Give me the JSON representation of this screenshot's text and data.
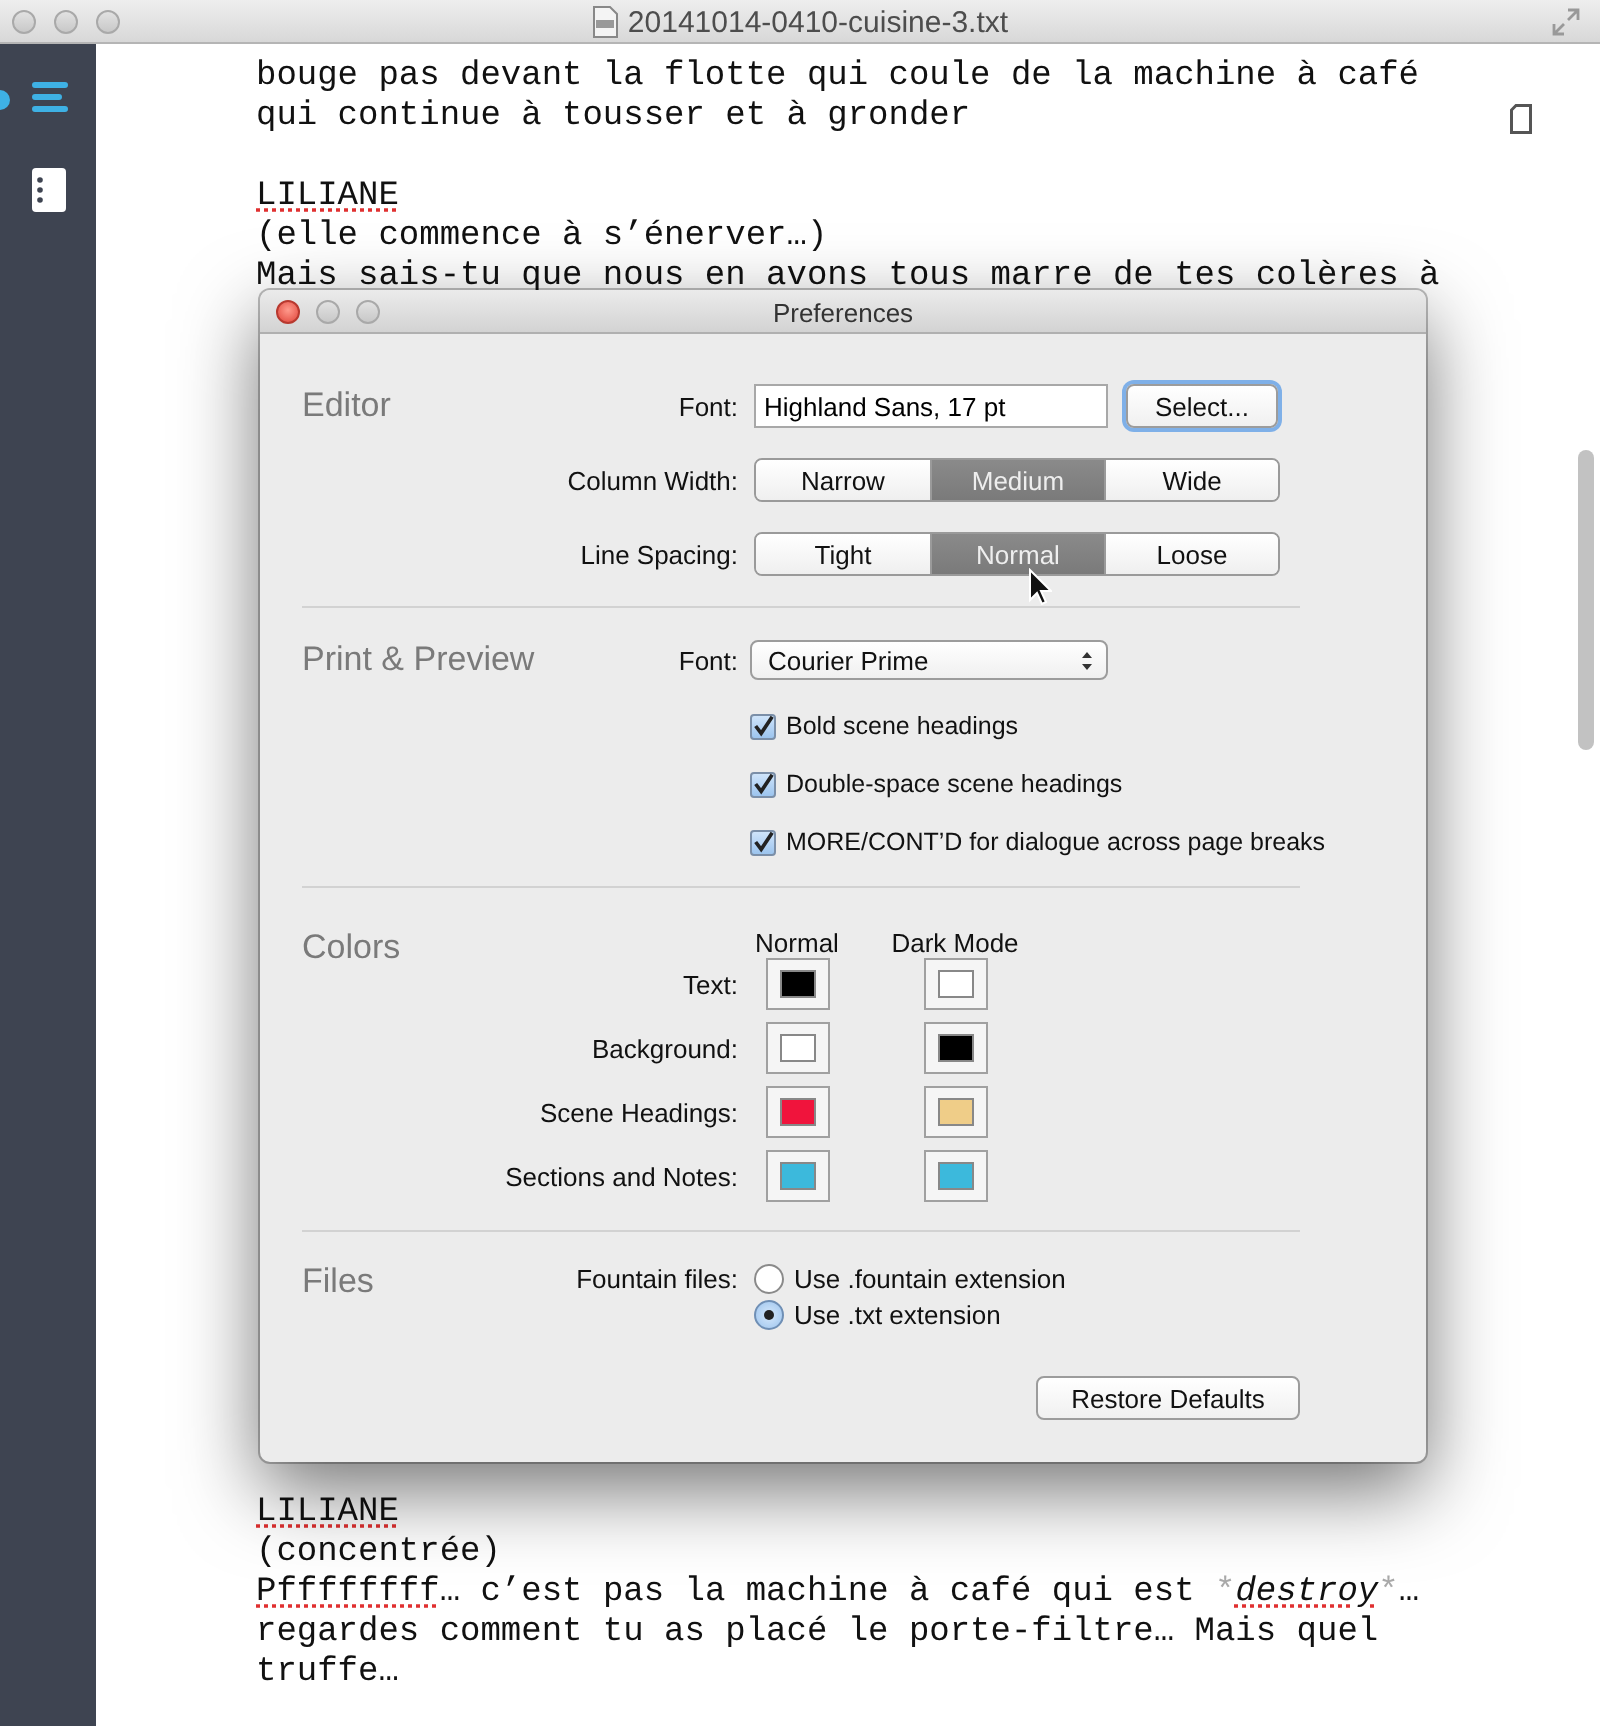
{
  "window": {
    "title": "20141014-0410-cuisine-3.txt"
  },
  "editor": {
    "lines_top": [
      {
        "kind": "text",
        "segments": [
          {
            "text": "bouge pas devant la flotte qui coule de la machine à café",
            "kind": "plain",
            "misspelled": false
          }
        ]
      },
      {
        "kind": "text",
        "segments": [
          {
            "text": "qui continue à tousser et à gronder",
            "kind": "plain",
            "misspelled": false
          }
        ]
      },
      {
        "kind": "blank"
      },
      {
        "kind": "text",
        "segments": [
          {
            "text": "LILIANE",
            "kind": "plain",
            "misspelled": true
          }
        ]
      },
      {
        "kind": "text",
        "segments": [
          {
            "text": "(elle commence à s’énerver…)",
            "kind": "plain",
            "misspelled": false
          }
        ]
      },
      {
        "kind": "text",
        "segments": [
          {
            "text": "Mais sais-tu que nous en avons tous marre de tes colères à",
            "kind": "plain",
            "misspelled": false
          }
        ]
      }
    ],
    "lines_bottom": [
      {
        "kind": "text",
        "segments": [
          {
            "text": "LILIANE",
            "kind": "plain",
            "misspelled": true
          }
        ]
      },
      {
        "kind": "text",
        "segments": [
          {
            "text": "(concentrée)",
            "kind": "plain",
            "misspelled": false
          }
        ]
      },
      {
        "kind": "text",
        "segments": [
          {
            "text": "Pffffffff",
            "kind": "plain",
            "misspelled": true
          },
          {
            "text": "… c’est pas la machine à café qui est ",
            "kind": "plain",
            "misspelled": false
          },
          {
            "text": "*",
            "kind": "marker",
            "misspelled": false
          },
          {
            "text": "destroy",
            "kind": "emphasis",
            "misspelled": true
          },
          {
            "text": "*",
            "kind": "marker",
            "misspelled": false
          },
          {
            "text": "…",
            "kind": "plain",
            "misspelled": false
          }
        ]
      },
      {
        "kind": "text",
        "segments": [
          {
            "text": "regardes comment tu as placé le porte-filtre… Mais quel",
            "kind": "plain",
            "misspelled": false
          }
        ]
      },
      {
        "kind": "text",
        "segments": [
          {
            "text": "truffe…",
            "kind": "plain",
            "misspelled": false
          }
        ]
      }
    ]
  },
  "preferences": {
    "title": "Preferences",
    "editor": {
      "heading": "Editor",
      "font_label": "Font:",
      "font_value": "Highland Sans, 17 pt",
      "select_button": "Select...",
      "column_width": {
        "label": "Column Width:",
        "options": [
          {
            "label": "Narrow",
            "selected": false
          },
          {
            "label": "Medium",
            "selected": true
          },
          {
            "label": "Wide",
            "selected": false
          }
        ]
      },
      "line_spacing": {
        "label": "Line Spacing:",
        "options": [
          {
            "label": "Tight",
            "selected": false
          },
          {
            "label": "Normal",
            "selected": true
          },
          {
            "label": "Loose",
            "selected": false
          }
        ]
      }
    },
    "print_preview": {
      "heading": "Print & Preview",
      "font_label": "Font:",
      "font_popup": "Courier Prime",
      "checkboxes": [
        {
          "label": "Bold scene headings",
          "checked": true
        },
        {
          "label": "Double-space scene headings",
          "checked": true
        },
        {
          "label": "MORE/CONT’D for dialogue across page breaks",
          "checked": true
        }
      ]
    },
    "colors": {
      "heading": "Colors",
      "column_headers": [
        "Normal",
        "Dark Mode"
      ],
      "rows": [
        {
          "label": "Text:",
          "swatches": [
            {
              "color": "#000000"
            },
            {
              "color": "#ffffff"
            }
          ]
        },
        {
          "label": "Background:",
          "swatches": [
            {
              "color": "#ffffff"
            },
            {
              "color": "#000000"
            }
          ]
        },
        {
          "label": "Scene Headings:",
          "swatches": [
            {
              "color": "#f0143c"
            },
            {
              "color": "#efcd88"
            }
          ]
        },
        {
          "label": "Sections and Notes:",
          "swatches": [
            {
              "color": "#3cb9dc"
            },
            {
              "color": "#3cb9dc"
            }
          ]
        }
      ]
    },
    "files": {
      "heading": "Files",
      "label": "Fountain files:",
      "options": [
        {
          "label": "Use .fountain extension",
          "selected": false
        },
        {
          "label": "Use .txt extension",
          "selected": true
        }
      ]
    },
    "restore_button": "Restore Defaults"
  }
}
